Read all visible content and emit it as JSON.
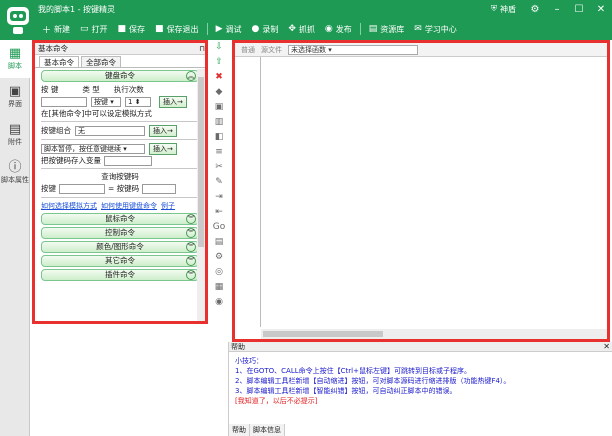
{
  "titlebar": {
    "title": "我的脚本1 - 按键精灵",
    "user_name": "神盾",
    "toolbar": [
      {
        "icon": "new-icon",
        "label": "新建",
        "glyph": "＋"
      },
      {
        "icon": "open-icon",
        "label": "打开",
        "glyph": "▭"
      },
      {
        "icon": "save-icon",
        "label": "保存",
        "glyph": "■"
      },
      {
        "icon": "save-exit-icon",
        "label": "保存退出",
        "glyph": "■"
      },
      {
        "icon": "debug-icon",
        "label": "调试",
        "glyph": "▶"
      },
      {
        "icon": "record-icon",
        "label": "录制",
        "glyph": "●"
      },
      {
        "icon": "capture-icon",
        "label": "抓抓",
        "glyph": "✥"
      },
      {
        "icon": "publish-icon",
        "label": "发布",
        "glyph": "◉"
      },
      {
        "icon": "resource-icon",
        "label": "资源库",
        "glyph": "▤"
      },
      {
        "icon": "learning-icon",
        "label": "学习中心",
        "glyph": "✉"
      }
    ]
  },
  "leftnav": [
    {
      "icon": "script-icon",
      "label": "脚本",
      "glyph": "▦",
      "active": true
    },
    {
      "icon": "ui-icon",
      "label": "界面",
      "glyph": "▣"
    },
    {
      "icon": "attachment-icon",
      "label": "附件",
      "glyph": "▤"
    },
    {
      "icon": "property-icon",
      "label": "脚本属性",
      "glyph": "ⓘ"
    }
  ],
  "command_panel": {
    "header": "基本命令",
    "tabs": [
      "基本命令",
      "全部命令"
    ],
    "keyboard_section": "键盘命令",
    "col_key": "按 键",
    "col_type": "类 型",
    "col_times": "执行次数",
    "type_value": "按键",
    "times_value": "1",
    "insert_label": "插入→",
    "sim_mode_text": "在[其他命令]中可以设定模拟方式",
    "combo_label": "按键组合",
    "combo_value": "无",
    "pause_label": "脚本暂停，按任意键继续",
    "save_var_label": "把按键码存入变量",
    "query_title": "查询按键码",
    "query_key_label": "按键",
    "query_code_label": "= 按键码",
    "link_sim": "如何选择模拟方式",
    "link_kbd": "如何使用键盘命令",
    "link_example": "例子",
    "sections": [
      "鼠标命令",
      "控制命令",
      "颜色/图形命令",
      "其它命令",
      "插件命令"
    ]
  },
  "editor": {
    "mode_source": "源文件",
    "mode_normal": "普通",
    "select_value": "未选择函数"
  },
  "help": {
    "title": "帮助",
    "tip_heading": "小技巧：",
    "tips": [
      "1、在GOTO、CALL命令上按住【Ctrl+鼠标左键】可跳转到目标或子程序。",
      "2、脚本编辑工具栏新增【自动缩进】按钮，可对脚本源码进行缩进排版（功能热键F4）。",
      "3、脚本编辑工具栏新增【智能纠错】按钮，可自动纠正脚本中的错误。"
    ],
    "dismiss": "[我知道了，以后不必提示]",
    "tabs": [
      "帮助",
      "脚本信息"
    ]
  },
  "colors": {
    "brand": "#1f9a55",
    "highlight": "#e8302f",
    "link": "#1a4fd6"
  }
}
